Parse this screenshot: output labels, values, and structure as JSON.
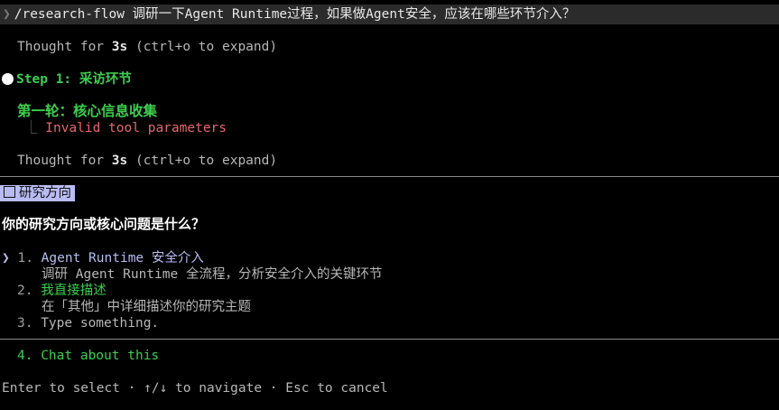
{
  "prompt": {
    "caret": "❯",
    "text": "/research-flow 调研一下Agent Runtime过程，如果做Agent安全，应该在哪些环节介入？"
  },
  "thought1": {
    "prefix": "Thought for ",
    "duration": "3s",
    "suffix": " (ctrl+o to expand)"
  },
  "step": {
    "label": "Step 1: 采访环节"
  },
  "round": {
    "title": "第一轮：核心信息收集",
    "tree_char": "⎿",
    "error": "Invalid tool parameters"
  },
  "thought2": {
    "prefix": "Thought for ",
    "duration": "3s",
    "suffix": " (ctrl+o to expand)"
  },
  "question": {
    "tag": "研究方向",
    "title": "你的研究方向或核心问题是什么？",
    "selected_caret": "❯",
    "options": [
      {
        "num": "1.",
        "label": "Agent Runtime 安全介入",
        "desc": "调研 Agent Runtime 全流程，分析安全介入的关键环节"
      },
      {
        "num": "2.",
        "label": "我直接描述",
        "desc": "在「其他」中详细描述你的研究主题"
      },
      {
        "num": "3.",
        "label": "Type something."
      },
      {
        "num": "4.",
        "label": "Chat about this"
      }
    ]
  },
  "footer": {
    "text": "Enter to select · ↑/↓ to navigate · Esc to cancel"
  },
  "colors": {
    "background": "#000000",
    "accent_green": "#3ccf4e",
    "error_red": "#e8656e",
    "selection_lavender": "#b9bcf2"
  }
}
